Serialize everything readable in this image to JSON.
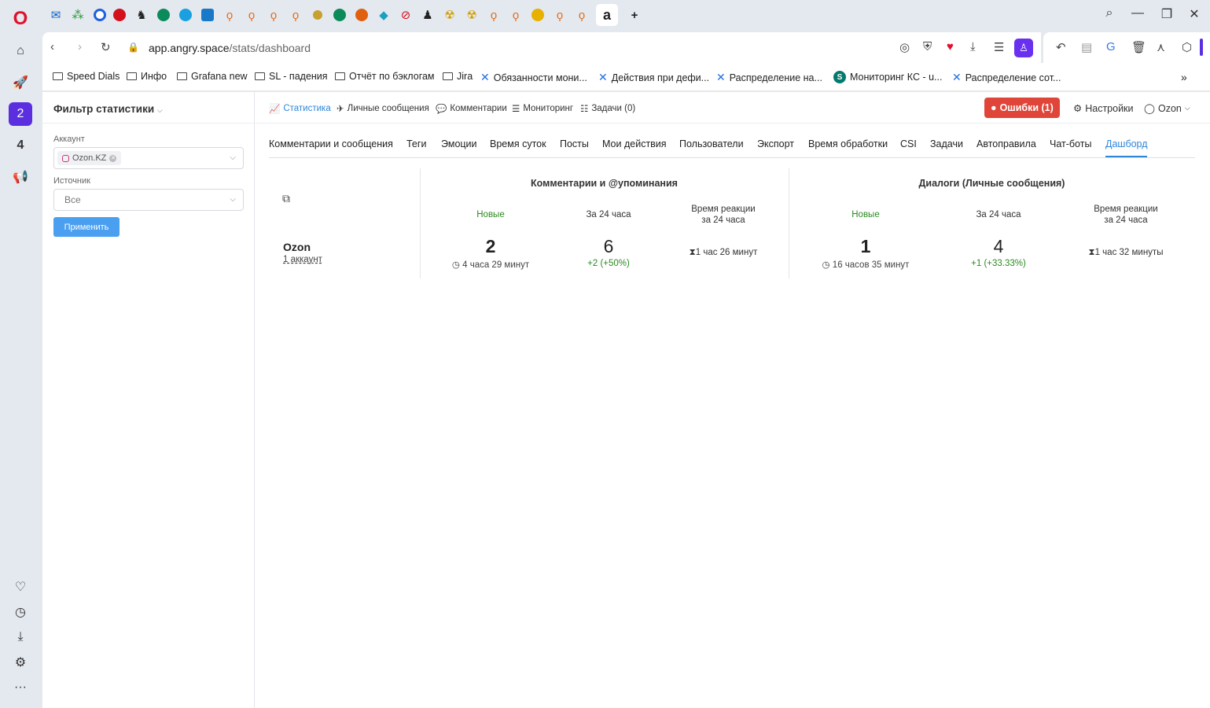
{
  "browser": {
    "url_host": "app.angry.space",
    "url_path": "/stats/dashboard",
    "active_tab_glyph": "a",
    "new_tab_label": "+"
  },
  "bookmarks": [
    {
      "label": "Speed Dials",
      "icon": "folder-icon"
    },
    {
      "label": "Инфо",
      "icon": "folder-icon"
    },
    {
      "label": "Grafana new",
      "icon": "folder-icon"
    },
    {
      "label": "SL - падения",
      "icon": "folder-icon"
    },
    {
      "label": "Отчёт по бэклогам",
      "icon": "folder-icon"
    },
    {
      "label": "Jira",
      "icon": "folder-icon"
    },
    {
      "label": "Обязанности мони...",
      "icon": "confluence-icon"
    },
    {
      "label": "Действия при дефи...",
      "icon": "confluence-icon"
    },
    {
      "label": "Распределение на...",
      "icon": "confluence-icon"
    },
    {
      "label": "Мониторинг КС - u...",
      "icon": "sharepoint-icon"
    },
    {
      "label": "Распределение сот...",
      "icon": "confluence-icon"
    }
  ],
  "opera_sidebar": {
    "badge_2": "2",
    "badge_4": "4"
  },
  "filter": {
    "title": "Фильтр статистики",
    "account_label": "Аккаунт",
    "account_chip": "Ozon.KZ",
    "source_label": "Источник",
    "source_placeholder": "Все",
    "apply_label": "Применить"
  },
  "topnav": {
    "stats": "Статистика",
    "messages": "Личные сообщения",
    "comments": "Комментарии",
    "monitoring": "Мониторинг",
    "tasks": "Задачи (0)",
    "errors": "Ошибки (1)",
    "settings": "Настройки",
    "user": "Ozon"
  },
  "subtabs": [
    "Комментарии и сообщения",
    "Теги",
    "Эмоции",
    "Время суток",
    "Посты",
    "Мои действия",
    "Пользователи",
    "Экспорт",
    "Время обработки",
    "CSI",
    "Задачи",
    "Автоправила",
    "Чат-боты",
    "Дашборд"
  ],
  "dashboard": {
    "account_name": "Ozon",
    "account_count": "1 аккаунт",
    "comments": {
      "title": "Комментарии и @упоминания",
      "new_label": "Новые",
      "day_label": "За 24 часа",
      "reaction_label_1": "Время реакции",
      "reaction_label_2": "за 24 часа",
      "new_value": "2",
      "new_age": "4 часа 29 минут",
      "day_value": "6",
      "day_delta": "+2 (+50%)",
      "reaction_value": "1 час 26 минут"
    },
    "dialogs": {
      "title": "Диалоги (Личные сообщения)",
      "new_label": "Новые",
      "day_label": "За 24 часа",
      "reaction_label_1": "Время реакции",
      "reaction_label_2": "за 24 часа",
      "new_value": "1",
      "new_age": "16 часов 35 минут",
      "day_value": "4",
      "day_delta": "+1 (+33.33%)",
      "reaction_value": "1 час 32 минуты"
    }
  },
  "colors": {
    "accent": "#2f86d9",
    "error": "#e0453a",
    "positive": "#2b8a1f",
    "opera_red": "#e0102c",
    "opera_active": "#5b2fe0"
  }
}
